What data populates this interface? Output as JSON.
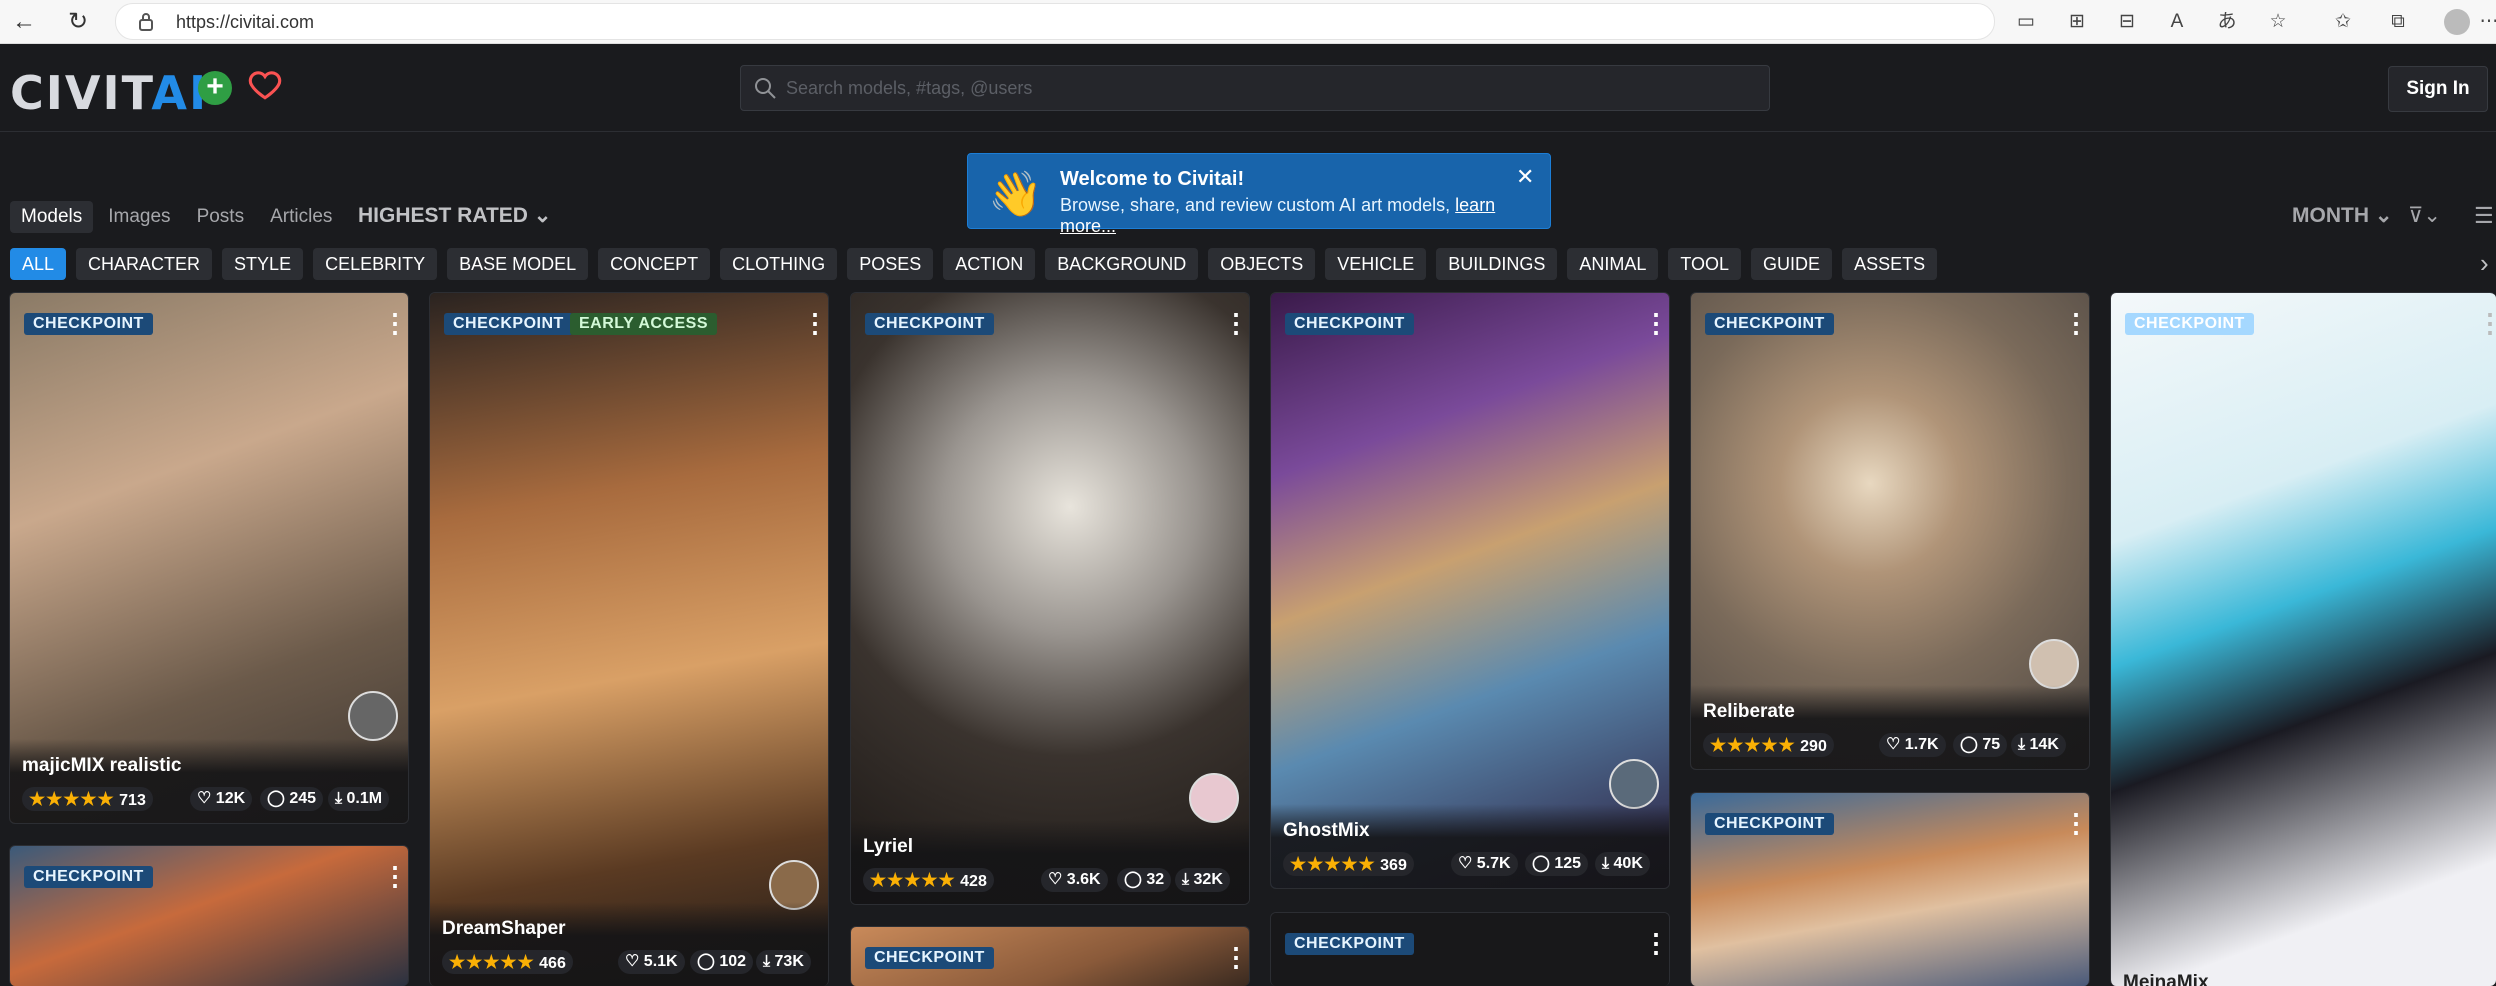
{
  "browser": {
    "url": "https://civitai.com"
  },
  "search": {
    "placeholder": "Search models, #tags, @users"
  },
  "header": {
    "logo_a": "CIVIT",
    "logo_b": "AI",
    "sign_in": "Sign In"
  },
  "welcome": {
    "title": "Welcome to Civitai!",
    "subtitle": "Browse, share, and review custom AI art models, ",
    "link": "learn more...",
    "emoji": "👋"
  },
  "tabs": [
    "Models",
    "Images",
    "Posts",
    "Articles"
  ],
  "sort_label": "HIGHEST RATED",
  "period_label": "MONTH",
  "categories": [
    "ALL",
    "CHARACTER",
    "STYLE",
    "CELEBRITY",
    "BASE MODEL",
    "CONCEPT",
    "CLOTHING",
    "POSES",
    "ACTION",
    "BACKGROUND",
    "OBJECTS",
    "VEHICLE",
    "BUILDINGS",
    "ANIMAL",
    "TOOL",
    "GUIDE",
    "ASSETS"
  ],
  "badges": {
    "checkpoint": "CHECKPOINT",
    "early_access": "EARLY ACCESS"
  },
  "cards": [
    {
      "name": "majicMIX realistic",
      "rating": "713",
      "likes": "12K",
      "comments": "245",
      "downloads": "0.1M"
    },
    {
      "name": "DreamShaper",
      "rating": "466",
      "likes": "5.1K",
      "comments": "102",
      "downloads": "73K"
    },
    {
      "name": "Lyriel",
      "rating": "428",
      "likes": "3.6K",
      "comments": "32",
      "downloads": "32K"
    },
    {
      "name": "GhostMix",
      "rating": "369",
      "likes": "5.7K",
      "comments": "125",
      "downloads": "40K"
    },
    {
      "name": "Reliberate",
      "rating": "290",
      "likes": "1.7K",
      "comments": "75",
      "downloads": "14K"
    },
    {
      "name": "MeinaMix"
    }
  ],
  "stars": "★★★★★",
  "colors": {
    "accent": "#228be6",
    "star": "#fab005",
    "badge": "#1c4a78"
  }
}
